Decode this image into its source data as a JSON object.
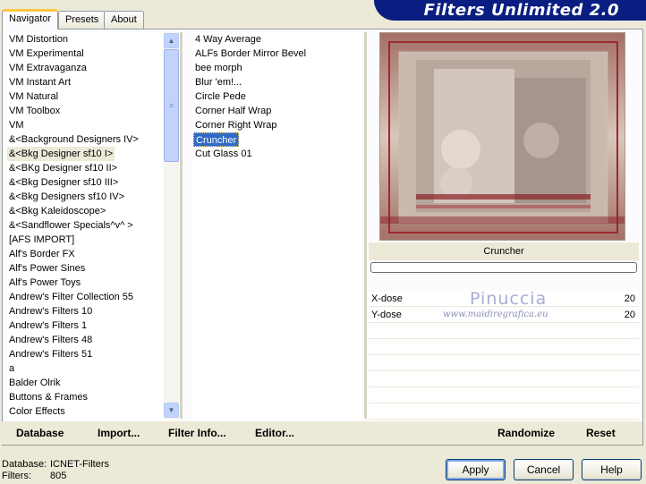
{
  "tabs": [
    "Navigator",
    "Presets",
    "About"
  ],
  "app_title": "Filters Unlimited 2.0",
  "categories": [
    "VM Distortion",
    "VM Experimental",
    "VM Extravaganza",
    "VM Instant Art",
    "VM Natural",
    "VM Toolbox",
    "VM",
    "&<Background Designers IV>",
    "&<Bkg Designer sf10 I>",
    "&<BKg Designer sf10 II>",
    "&<Bkg Designer sf10 III>",
    "&<Bkg Designers sf10 IV>",
    "&<Bkg Kaleidoscope>",
    "&<Sandflower Specials^v^ >",
    "[AFS IMPORT]",
    "Alf's Border FX",
    "Alf's Power Sines",
    "Alf's Power Toys",
    "Andrew's Filter Collection 55",
    "Andrew's Filters 10",
    "Andrew's Filters 1",
    "Andrew's Filters 48",
    "Andrew's Filters 51",
    "a",
    "Balder Olrik",
    "Buttons & Frames",
    "Color Effects"
  ],
  "selected_category": "&<Bkg Designer sf10 I>",
  "filters": [
    "4 Way Average",
    "ALFs Border Mirror Bevel",
    "bee morph",
    "Blur 'em!...",
    "Circle Pede",
    "Corner Half Wrap",
    "Corner Right Wrap",
    "Cruncher",
    "Cut Glass 01"
  ],
  "selected_filter": "Cruncher",
  "preview": {
    "filter_name": "Cruncher",
    "progress": 0
  },
  "params": [
    {
      "label": "X-dose",
      "value": "20"
    },
    {
      "label": "Y-dose",
      "value": "20"
    }
  ],
  "watermark": {
    "name": "Pinuccia",
    "url": "www.maidiregrafica.eu"
  },
  "links": {
    "database": "Database",
    "import": "Import...",
    "filter_info": "Filter Info...",
    "editor": "Editor...",
    "randomize": "Randomize",
    "reset": "Reset"
  },
  "status": {
    "database_label": "Database:",
    "database_value": "ICNET-Filters",
    "filters_label": "Filters:",
    "filters_value": "805"
  },
  "buttons": {
    "apply": "Apply",
    "cancel": "Cancel",
    "help": "Help"
  },
  "colors": {
    "banner": "#0a1e82",
    "selection": "#316ac5",
    "window": "#ece9d8"
  }
}
